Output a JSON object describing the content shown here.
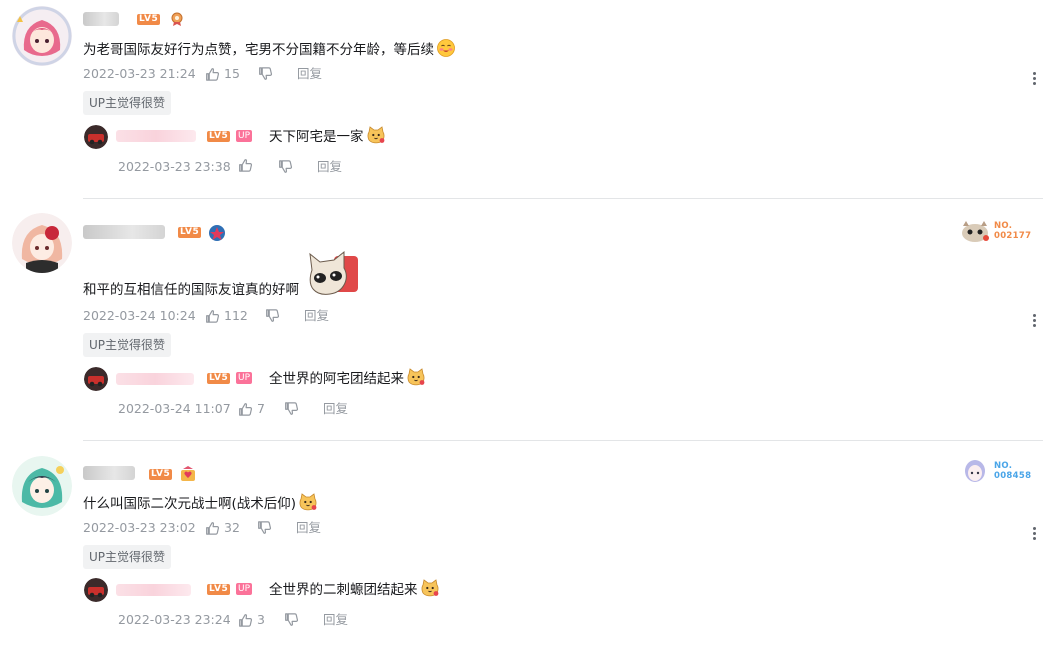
{
  "comments": [
    {
      "level": "LV5",
      "text": "为老哥国际友好行为点赞，宅男不分国籍不分年龄，等后续",
      "time": "2022-03-23 21:24",
      "likes": "15",
      "reply_label": "回复",
      "up_liked": "UP主觉得很赞",
      "reply": {
        "level": "LV5",
        "up_tag": "UP",
        "text": "天下阿宅是一家",
        "time": "2022-03-23 23:38",
        "likes": "",
        "reply_label": "回复"
      }
    },
    {
      "level": "LV5",
      "text": "和平的互相信任的国际友谊真的好啊",
      "time": "2022-03-24 10:24",
      "likes": "112",
      "reply_label": "回复",
      "up_liked": "UP主觉得很赞",
      "fan_badge": {
        "label": "NO.",
        "number": "002177",
        "color": "#f18a47"
      },
      "reply": {
        "level": "LV5",
        "up_tag": "UP",
        "text": "全世界的阿宅团结起来",
        "time": "2022-03-24 11:07",
        "likes": "7",
        "reply_label": "回复"
      }
    },
    {
      "level": "LV5",
      "text": "什么叫国际二次元战士啊(战术后仰)",
      "time": "2022-03-23 23:02",
      "likes": "32",
      "reply_label": "回复",
      "up_liked": "UP主觉得很赞",
      "fan_badge": {
        "label": "NO.",
        "number": "008458",
        "color": "#4aa5e8"
      },
      "reply": {
        "level": "LV5",
        "up_tag": "UP",
        "text": "全世界的二刺螈团结起来",
        "time": "2022-03-23 23:24",
        "likes": "3",
        "reply_label": "回复"
      }
    }
  ],
  "colors": {
    "text": "#18191c",
    "meta": "#9499a0",
    "level": "#f18a47",
    "up": "#fb7299",
    "divider": "#e3e5e7"
  },
  "icons": [
    "thumb-up-icon",
    "thumb-down-icon",
    "more-vertical-icon",
    "medal-icon",
    "cat-emoji-icon"
  ]
}
